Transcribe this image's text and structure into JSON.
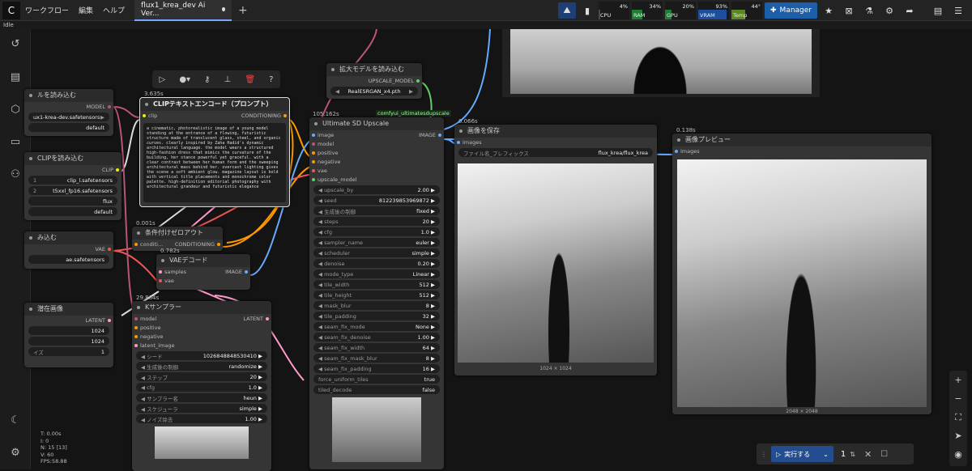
{
  "menu": {
    "logo": "",
    "workflow": "ワークフロー",
    "edit": "編集",
    "help": "ヘルプ"
  },
  "tab": {
    "title": "flux1_krea_dev Ai Ver..."
  },
  "meters": [
    {
      "label": "CPU",
      "pct": "4%",
      "value": 4,
      "color": "#4a4a4a"
    },
    {
      "label": "RAM",
      "pct": "34%",
      "value": 34,
      "color": "#1e7e34"
    },
    {
      "label": "GPU",
      "pct": "20%",
      "value": 20,
      "color": "#1e7e34"
    },
    {
      "label": "VRAM",
      "pct": "93%",
      "value": 93,
      "color": "#1d4f9e"
    },
    {
      "label": "Temp",
      "pct": "44°",
      "value": 44,
      "color": "#5a8a1e"
    }
  ],
  "manager": "Manager",
  "status": "Idle",
  "stats": [
    "T: 0.00s",
    "I: 0",
    "N: 15 [13]",
    "V: 60",
    "FPS:58.88"
  ],
  "nodes": {
    "clip_text": {
      "time": "3.635s",
      "title": "CLIPテキストエンコード（プロンプト）",
      "in": "clip",
      "out": "CONDITIONING",
      "prompt": "a cinematic, photorealistic image of a young model standing at the entrance of a flowing, futuristic structure made of translucent glass, steel, and organic curves. clearly inspired by Zaha Hadid's dynamic architectural language. the model wears a structured high-fashion dress that mimics the curvature of the building, her stance powerful yet graceful. with a clear contrast between her human form and the sweeping architectural mass behind her. overcast lighting gives the scene a soft ambient glow. magazine layout is bold with vertical title placements and monochrome color palette. high-definition editorial photography with architectural grandeur and futuristic elegance"
    },
    "model_loader": {
      "title": "ルを読み込む",
      "out": "MODEL",
      "v1": "ux1-krea-dev.safetensors",
      "v2": "default"
    },
    "dual_clip": {
      "title": "CLIPを読み込む",
      "out": "CLIP",
      "r1l": "1",
      "r1": "clip_l.safetensors",
      "r2l": "2",
      "r2": "t5xxl_fp16.safetensors",
      "r3": "flux",
      "r4": "default"
    },
    "vae_loader": {
      "title": "み込む",
      "out": "VAE",
      "v1": "ae.safetensors"
    },
    "empty_latent": {
      "title": "潜在画像",
      "out": "LATENT",
      "w": "1024",
      "h": "1024",
      "bl": "イズ",
      "b": "1"
    },
    "zero_out": {
      "time": "0.001s",
      "title": "条件付けゼロアウト",
      "in": "conditi...",
      "out": "CONDITIONING"
    },
    "vae_decode": {
      "time": "0.782s",
      "title": "VAEデコード",
      "in1": "samples",
      "in2": "vae",
      "out": "IMAGE"
    },
    "ksampler": {
      "time": "29.864s",
      "title": "Kサンプラー",
      "ins": [
        "model",
        "positive",
        "negative",
        "latent_image"
      ],
      "out": "LATENT",
      "widgets": [
        [
          "シード",
          "1026848848530410"
        ],
        [
          "生成後の制御",
          "randomize"
        ],
        [
          "ステップ",
          "20"
        ],
        [
          "cfg",
          "1.0"
        ],
        [
          "サンプラー名",
          "heun"
        ],
        [
          "スケジューラ",
          "simple"
        ],
        [
          "ノイズ除去",
          "1.00"
        ]
      ]
    },
    "upscale_loader": {
      "title": "拡大モデルを読み込む",
      "out": "UPSCALE_MODEL",
      "v": "RealESRGAN_x4.pth"
    },
    "usdu": {
      "time": "105.162s",
      "badge": "comfyui_ultimatesdupscale",
      "title": "Ultimate SD Upscale",
      "out": "IMAGE",
      "ins": [
        "image",
        "model",
        "positive",
        "negative",
        "vae",
        "upscale_model"
      ],
      "widgets": [
        [
          "upscale_by",
          "2.00"
        ],
        [
          "seed",
          "812239853969872"
        ],
        [
          "生成後の制御",
          "fixed"
        ],
        [
          "steps",
          "20"
        ],
        [
          "cfg",
          "1.0"
        ],
        [
          "sampler_name",
          "euler"
        ],
        [
          "scheduler",
          "simple"
        ],
        [
          "denoise",
          "0.20"
        ],
        [
          "mode_type",
          "Linear"
        ],
        [
          "tile_width",
          "512"
        ],
        [
          "tile_height",
          "512"
        ],
        [
          "mask_blur",
          "8"
        ],
        [
          "tile_padding",
          "32"
        ],
        [
          "seam_fix_mode",
          "None"
        ],
        [
          "seam_fix_denoise",
          "1.00"
        ],
        [
          "seam_fix_width",
          "64"
        ],
        [
          "seam_fix_mask_blur",
          "8"
        ],
        [
          "seam_fix_padding",
          "16"
        ]
      ],
      "toggles": [
        [
          "force_uniform_tiles",
          "true"
        ],
        [
          "tiled_decode",
          "false"
        ]
      ]
    },
    "save": {
      "time": "0.066s",
      "title": "画像を保存",
      "in": "images",
      "pl": "ファイル名_プレフィックス",
      "pv": "flux_krea/flux_krea",
      "size": "1024 × 1024"
    },
    "preview": {
      "time": "0.138s",
      "title": "画像プレビュー",
      "in": "images",
      "size": "2048 × 2048"
    }
  },
  "run": {
    "label": "実行する",
    "count": "1"
  }
}
